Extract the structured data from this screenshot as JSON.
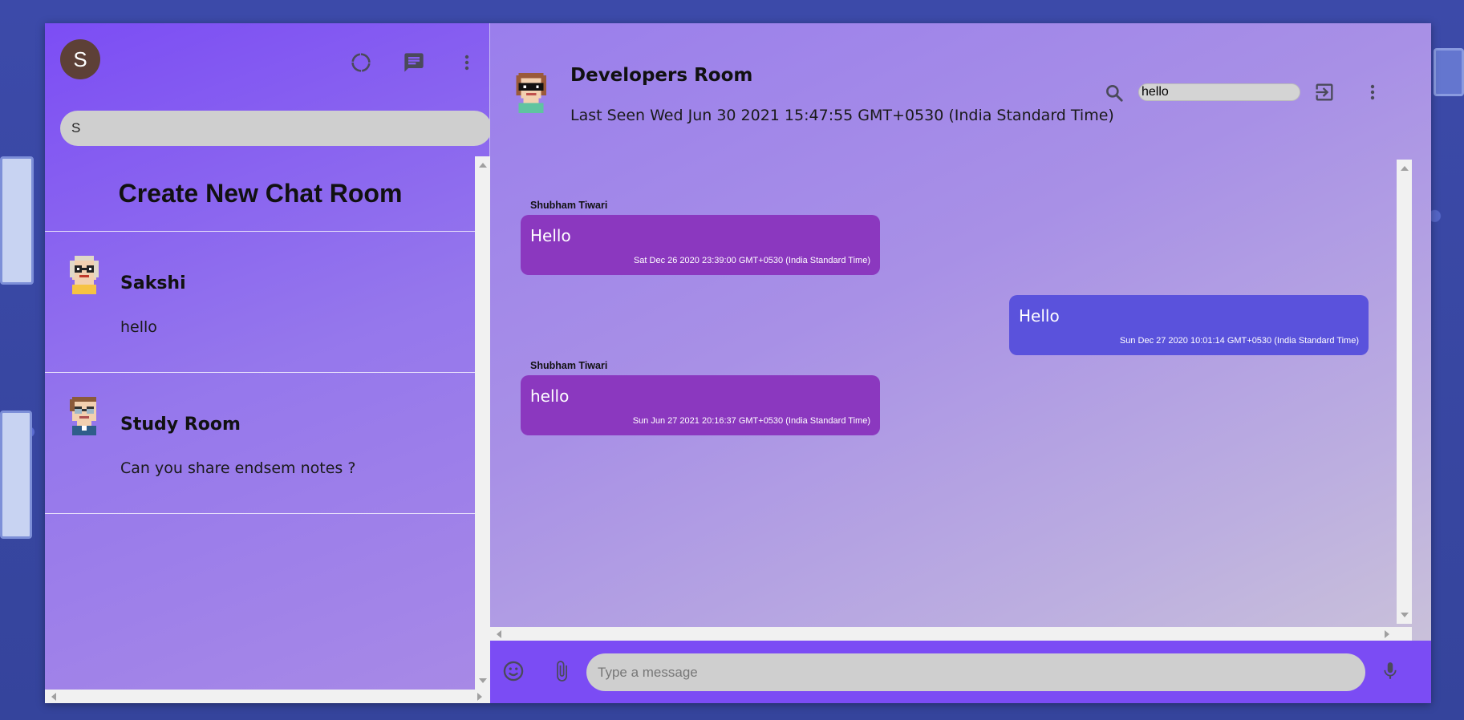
{
  "sidebar": {
    "user_avatar_letter": "S",
    "search_value": "S",
    "create_room_label": "Create New Chat Room",
    "chats": [
      {
        "name": "Sakshi",
        "last_message": "hello"
      },
      {
        "name": "Study Room",
        "last_message": "Can you share endsem notes ?"
      }
    ]
  },
  "chat": {
    "room_name": "Developers Room",
    "last_seen": "Last Seen Wed Jun 30 2021 15:47:55 GMT+0530 (India Standard Time)",
    "search_value": "hello",
    "messages": [
      {
        "sender": "Shubham Tiwari",
        "text": "Hello",
        "timestamp": "Sat Dec 26 2020 23:39:00 GMT+0530 (India Standard Time)",
        "direction": "received"
      },
      {
        "sender": "",
        "text": "Hello",
        "timestamp": "Sun Dec 27 2020 10:01:14 GMT+0530 (India Standard Time)",
        "direction": "sent"
      },
      {
        "sender": "Shubham Tiwari",
        "text": "hello",
        "timestamp": "Sun Jun 27 2021 20:16:37 GMT+0530 (India Standard Time)",
        "direction": "received"
      }
    ],
    "composer_placeholder": "Type a message"
  },
  "colors": {
    "accent": "#7b4cf4",
    "received_bubble": "#8b38bf",
    "sent_bubble": "#5a52dc"
  }
}
